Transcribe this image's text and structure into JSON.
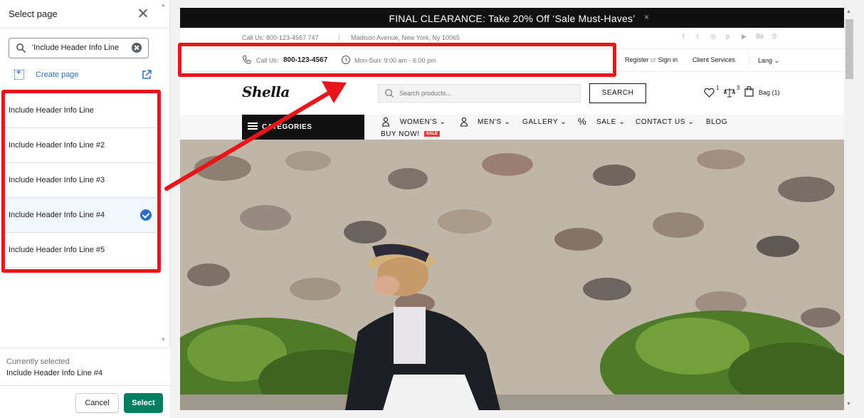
{
  "panel": {
    "title": "Select page",
    "search_value": "'Include Header Info Line",
    "create_label": "Create page",
    "items": [
      {
        "label": "Include Header Info Line"
      },
      {
        "label": "Include Header Info Line #2"
      },
      {
        "label": "Include Header Info Line #3"
      },
      {
        "label": "Include Header Info Line #4",
        "selected": true
      },
      {
        "label": "Include Header Info Line #5"
      }
    ],
    "current_label": "Currently selected",
    "current_value": "Include Header Info Line #4",
    "cancel_label": "Cancel",
    "select_label": "Select"
  },
  "store": {
    "announcement": "FINAL CLEARANCE: Take 20% Off ‘Sale Must-Haves’",
    "announcement_close": "×",
    "topline": {
      "phone": "Call Us: 800-123-4567 747",
      "separator": "|",
      "address": "Madison Avenue, New York, Ny 10065",
      "social": [
        "f",
        "t",
        "◎",
        "p",
        "▶",
        "Bē",
        "S"
      ]
    },
    "infoline": {
      "call_label": "Call Us:",
      "call_number": "800-123-4567",
      "hours": "Mon-Sun: 9:00 am - 6:00 pm",
      "register": "Register",
      "or": "or",
      "signin": "Sign in",
      "client_services": "Client Services",
      "lang": "Lang"
    },
    "logo": "Shella",
    "search_placeholder": "Search products...",
    "search_button": "SEARCH",
    "wishlist_count": "1",
    "compare_count": "3",
    "bag_label": "Bag (1)",
    "categories_label": "CATEGORIES",
    "nav": {
      "womens": "WOMEN'S",
      "mens": "MEN'S",
      "gallery": "GALLERY",
      "sale": "SALE",
      "contact": "CONTACT US",
      "blog": "BLOG",
      "buy_now": "BUY NOW!",
      "sale_badge": "SALE"
    }
  },
  "colors": {
    "annotation_red": "#e8151b",
    "primary_green": "#008060",
    "link_blue": "#2c6ecb"
  }
}
